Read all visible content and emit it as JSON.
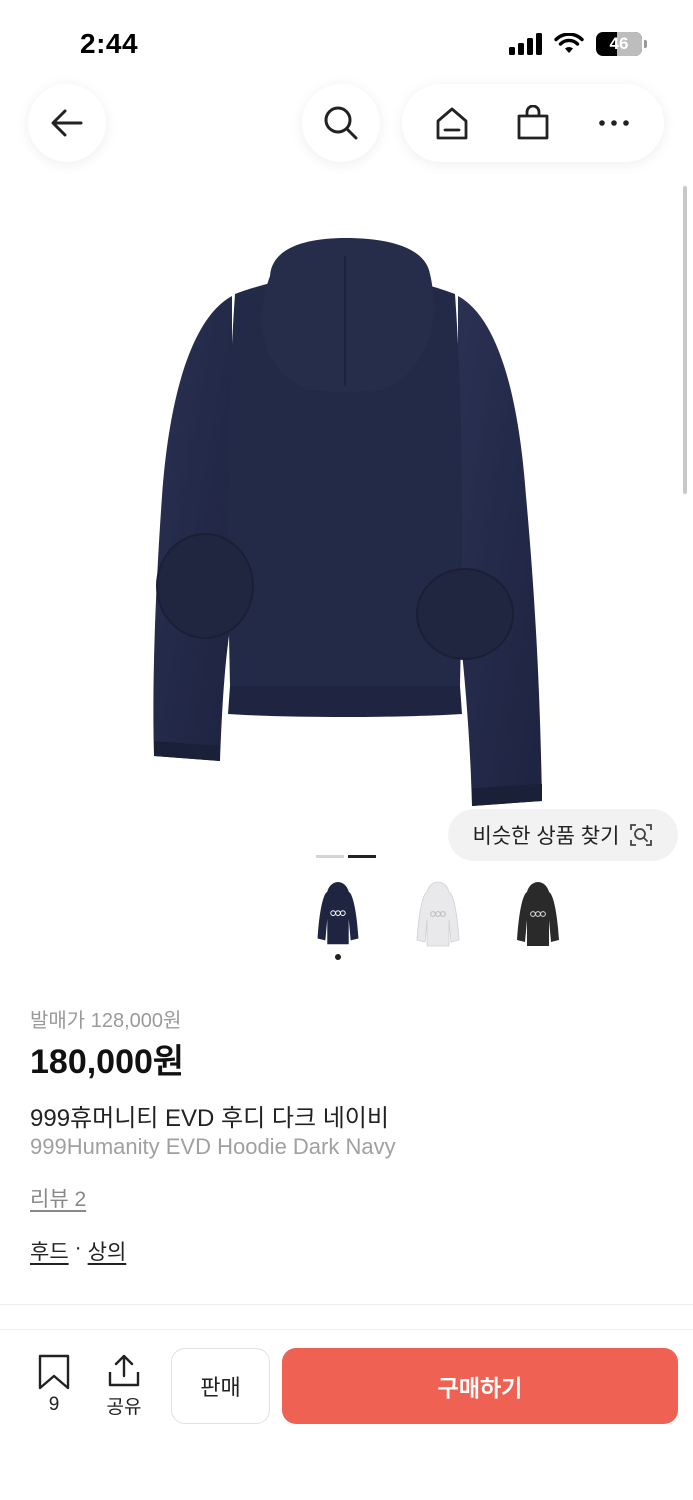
{
  "status": {
    "time": "2:44",
    "battery": "46"
  },
  "nav": {
    "back": "back-arrow-icon",
    "search": "search-icon",
    "home": "home-icon",
    "cart": "shopping-bag-icon",
    "more": "more-icon"
  },
  "similar": {
    "label": "비슷한 상품 찾기"
  },
  "product": {
    "release_price": "발매가 128,000원",
    "price": "180,000원",
    "name_ko": "999휴머니티 EVD 후디 다크 네이비",
    "name_en": "999Humanity EVD Hoodie Dark Navy",
    "review": "리뷰 2",
    "categories": [
      "후드",
      "상의"
    ],
    "category_sep": "·",
    "colors": [
      "#1f2540",
      "#ededed",
      "#2a2a2a"
    ]
  },
  "bottom": {
    "bookmark_count": "9",
    "share_label": "공유",
    "sell_label": "판매",
    "buy_label": "구매하기",
    "buy_color": "#ef6253"
  }
}
